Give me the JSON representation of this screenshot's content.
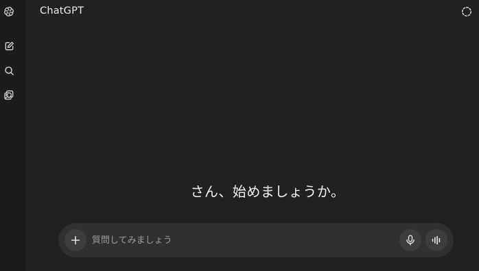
{
  "header": {
    "title": "ChatGPT"
  },
  "sidebar": {
    "icons": [
      "openai-logo-icon",
      "new-chat-icon",
      "search-icon",
      "library-icon"
    ]
  },
  "header_actions": {
    "icon": "temporary-chat-icon"
  },
  "main": {
    "greeting": "さん、始めましょうか。"
  },
  "composer": {
    "placeholder": "質問してみましょう",
    "value": "",
    "icons": [
      "plus-icon",
      "microphone-icon",
      "voice-mode-icon"
    ]
  },
  "colors": {
    "background": "#212121",
    "rail": "#1c1c1c",
    "composer": "#303030",
    "button": "#3d3d3d",
    "text": "#ececec",
    "placeholder": "#9b9b9b"
  }
}
